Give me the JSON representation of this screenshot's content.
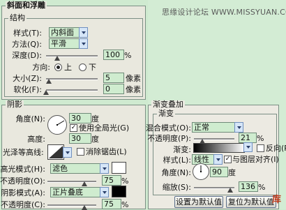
{
  "watermark": "思缘设计论坛  WWW.MISSYUAN.COM",
  "bevel": {
    "section_title": "斜面和浮雕",
    "group_title": "结构",
    "style_label": "样式(T):",
    "style_value": "内斜面",
    "technique_label": "方法(Q):",
    "technique_value": "平滑",
    "depth_label": "深度(D):",
    "depth_value": "100",
    "depth_unit": "%",
    "depth_level": 0.22,
    "direction_label": "方向:",
    "direction_up": "上",
    "direction_down": "下",
    "direction_selected": "上",
    "size_label": "大小(Z):",
    "size_value": "5",
    "size_unit": "像素",
    "size_level": 0.05,
    "soften_label": "软化(F):",
    "soften_value": "0",
    "soften_unit": "像素",
    "soften_level": 0.0
  },
  "shading": {
    "group_title": "阴影",
    "angle_label": "角度(N):",
    "angle_value": "30",
    "angle_unit": "度",
    "use_global_light_label": "使用全局光(G)",
    "use_global_light": true,
    "altitude_label": "高度:",
    "altitude_value": "30",
    "altitude_unit": "度",
    "gloss_contour_label": "光泽等高线:",
    "anti_aliased_label": "消除锯齿(L)",
    "anti_aliased": false,
    "highlight_mode_label": "高光模式(H):",
    "highlight_mode_value": "滤色",
    "highlight_color": "#ffffff",
    "highlight_opacity_label": "不透明度(O):",
    "highlight_opacity_value": "75",
    "highlight_opacity_unit": "%",
    "highlight_opacity_level": 0.75,
    "shadow_mode_label": "阴影模式(A):",
    "shadow_mode_value": "正片叠底",
    "shadow_color": "#000000",
    "shadow_opacity_label": "不透明度(C):",
    "shadow_opacity_value": "75",
    "shadow_opacity_unit": "%",
    "shadow_opacity_level": 0.75
  },
  "gradient_overlay": {
    "section_title": "渐变叠加",
    "group_title": "渐变",
    "blend_mode_label": "混合模式(O):",
    "blend_mode_value": "正常",
    "opacity_label": "不透明度(P):",
    "opacity_value": "21",
    "opacity_unit": "%",
    "opacity_level": 0.21,
    "gradient_label": "渐变:",
    "reverse_label": "反向(R)",
    "reverse": false,
    "style_label": "样式(L):",
    "style_value": "线性",
    "align_label": "与图层对齐(I)",
    "align": true,
    "angle_label": "角度(N):",
    "angle_value": "90",
    "angle_unit": "度",
    "scale_label": "缩放(S):",
    "scale_value": "136",
    "scale_unit": "%",
    "scale_level": 0.9,
    "default_button": "设置为默认值",
    "reset_button": "复位为默认值"
  },
  "corner_logo": "库"
}
